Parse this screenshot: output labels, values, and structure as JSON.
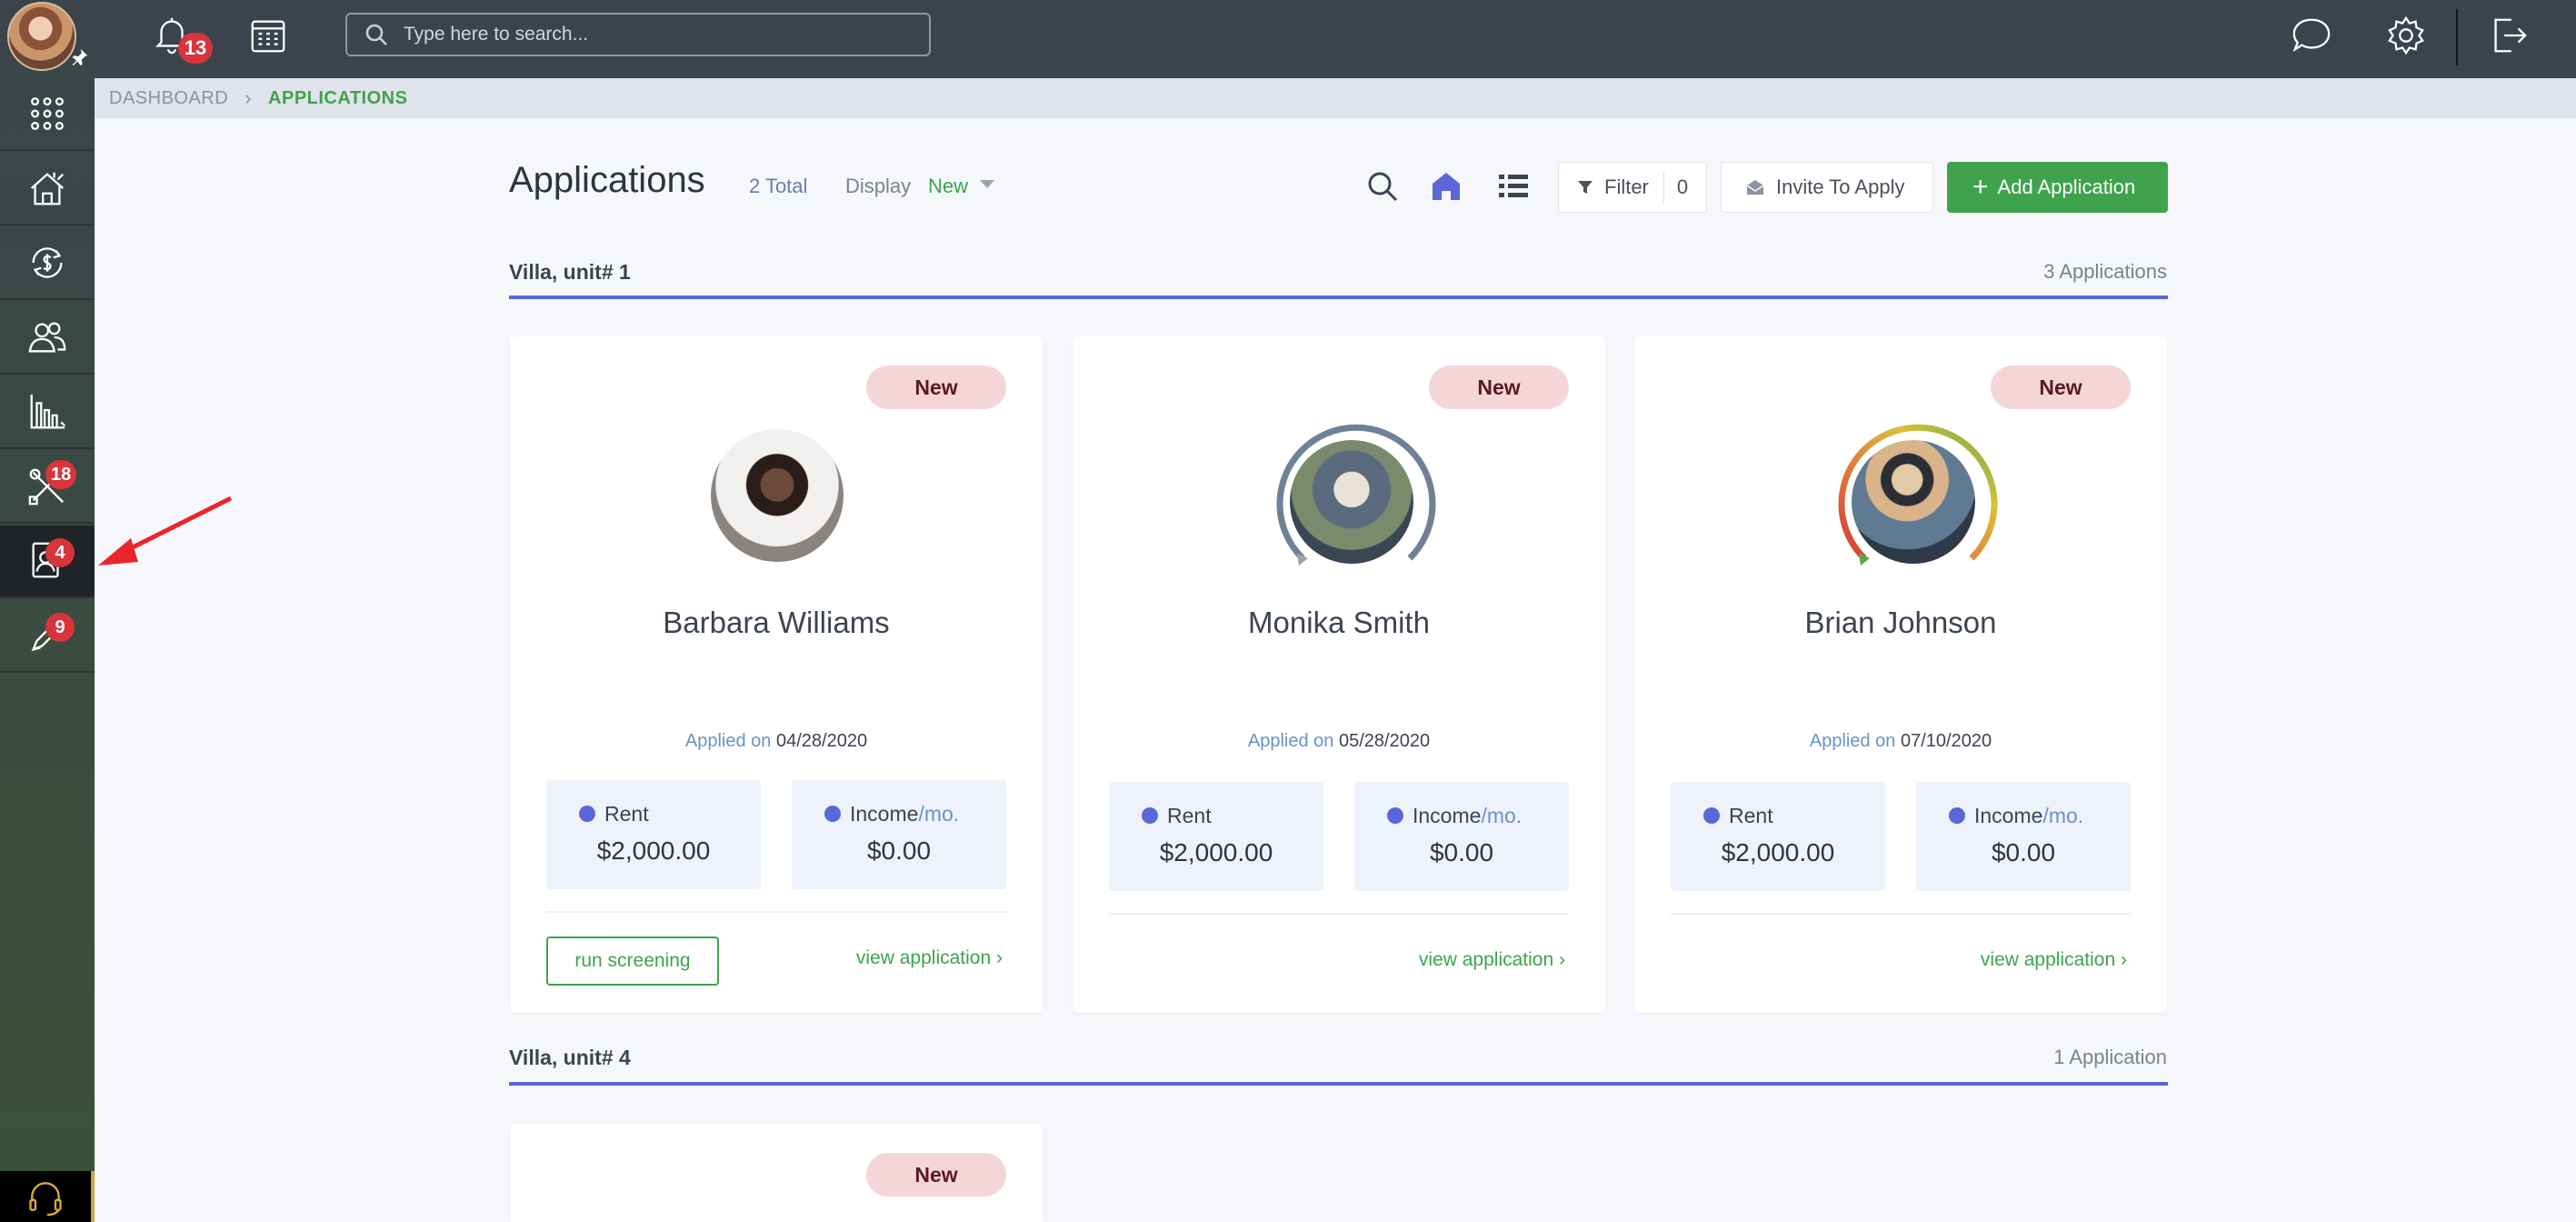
{
  "sidebar": {
    "badges": {
      "maintenance": "18",
      "applications": "4",
      "leases": "9"
    }
  },
  "topbar": {
    "notification_count": "13",
    "search": {
      "placeholder": "Type here to search..."
    }
  },
  "breadcrumb": {
    "root": "DASHBOARD",
    "current": "APPLICATIONS"
  },
  "page": {
    "title": "Applications",
    "total": "2 Total",
    "display_label": "Display",
    "display_value": "New",
    "filter_label": "Filter",
    "filter_count": "0",
    "invite_label": "Invite To Apply",
    "add_label": "Add Application"
  },
  "groups": [
    {
      "title": "Villa, unit# 1",
      "count": "3 Applications",
      "cards": [
        {
          "status": "New",
          "name": "Barbara Williams",
          "applied_prefix": "Applied on",
          "applied_date": "04/28/2020",
          "rent_label": "Rent",
          "rent": "$2,000.00",
          "income_label": "Income",
          "income_unit": "/mo.",
          "income": "$0.00",
          "screen_label": "run screening",
          "view_label": "view application ›"
        },
        {
          "status": "New",
          "name": "Monika Smith",
          "applied_prefix": "Applied on",
          "applied_date": "05/28/2020",
          "rent_label": "Rent",
          "rent": "$2,000.00",
          "income_label": "Income",
          "income_unit": "/mo.",
          "income": "$0.00",
          "view_label": "view application ›"
        },
        {
          "status": "New",
          "name": "Brian Johnson",
          "applied_prefix": "Applied on",
          "applied_date": "07/10/2020",
          "rent_label": "Rent",
          "rent": "$2,000.00",
          "income_label": "Income",
          "income_unit": "/mo.",
          "income": "$0.00",
          "view_label": "view application ›"
        }
      ]
    },
    {
      "title": "Villa, unit# 4",
      "count": "1 Application",
      "cards": [
        {
          "status": "New"
        }
      ]
    }
  ],
  "colors": {
    "accent": "#3fa34d",
    "brand_blue": "#5b67d8",
    "badge_red": "#d8343c",
    "topbar": "#3b444c"
  }
}
